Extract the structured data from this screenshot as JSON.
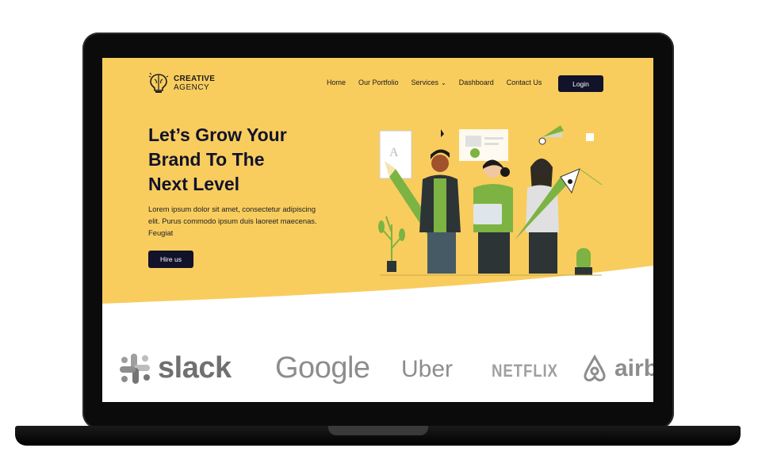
{
  "logo": {
    "line1": "CREATIVE",
    "line2": "AGENCY"
  },
  "nav": {
    "items": [
      {
        "label": "Home"
      },
      {
        "label": "Our Portfolio"
      },
      {
        "label": "Services"
      },
      {
        "label": "Dashboard"
      },
      {
        "label": "Contact Us"
      }
    ],
    "login_label": "Login"
  },
  "hero": {
    "title_lines": [
      "Let’s Grow Your",
      "Brand To The",
      "Next Level"
    ],
    "text": "Lorem ipsum dolor sit amet, consectetur adipiscing elit. Purus commodo ipsum duis laoreet maecenas. Feugiat",
    "cta_label": "Hire us"
  },
  "brands": {
    "slack": "slack",
    "google": "Google",
    "uber": "Uber",
    "netflix": "NETFLIX",
    "airbnb": "airb"
  },
  "colors": {
    "hero_bg": "#f8cd5e",
    "button_bg": "#12122a",
    "accent_green": "#7cb342"
  },
  "icons": [
    "lightbulb-brain-icon",
    "chevron-down-icon",
    "slack-icon",
    "airbnb-icon"
  ]
}
